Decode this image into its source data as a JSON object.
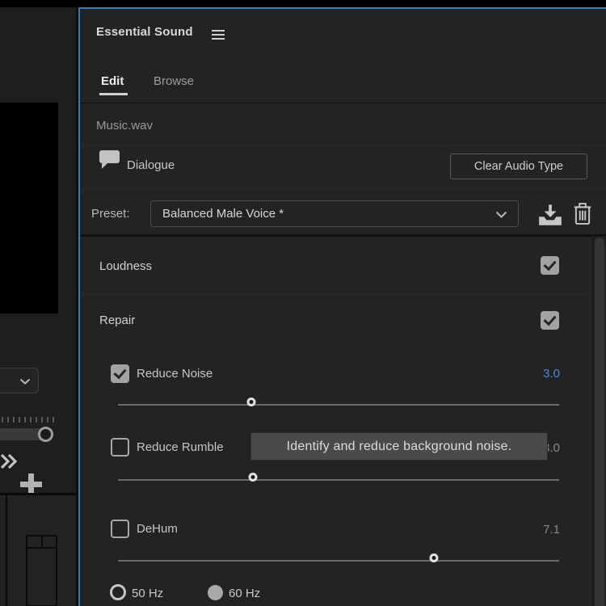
{
  "colors": {
    "panel_focus_border": "#3579B5",
    "panel_bg": "#232323",
    "accent_value_blue": "#3E8EE0",
    "tooltip_bg": "#4A4A4A"
  },
  "panel": {
    "title": "Essential Sound",
    "tabs": {
      "edit": "Edit",
      "browse": "Browse"
    },
    "clip_name": "Music.wav",
    "audio_type": {
      "label": "Dialogue",
      "clear_button_label": "Clear Audio Type"
    },
    "preset": {
      "label": "Preset:",
      "selected_value": "Balanced Male Voice *"
    },
    "loudness": {
      "label": "Loudness",
      "enabled": true
    },
    "repair": {
      "label": "Repair",
      "enabled": true
    },
    "controls": {
      "reduce_noise": {
        "label": "Reduce Noise",
        "checked": true,
        "value": "3.0",
        "slider_percent": 30.3
      },
      "reduce_rumble": {
        "label": "Reduce Rumble",
        "checked": false,
        "value": "3.0",
        "slider_percent": 30.6
      },
      "dehum": {
        "label": "DeHum",
        "checked": false,
        "value": "7.1",
        "slider_percent": 71.7
      }
    },
    "dehum_frequencies": [
      {
        "label": "50 Hz",
        "selected": false
      },
      {
        "label": "60 Hz",
        "selected": true
      }
    ],
    "tooltip_text": "Identify and reduce background noise."
  }
}
